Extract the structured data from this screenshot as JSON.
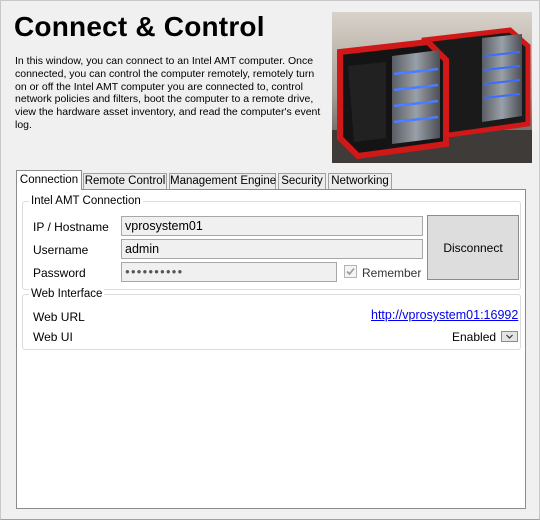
{
  "header": {
    "title": "Connect & Control",
    "description": "In this window, you can connect to an Intel AMT computer. Once connected, you can control the computer remotely, remotely turn on or off the Intel AMT computer you are connected to, control network policies and filters, boot the computer to a remote drive, view the hardware asset inventory, and read the computer's event log."
  },
  "tabs": [
    {
      "label": "Connection",
      "active": true
    },
    {
      "label": "Remote Control"
    },
    {
      "label": "Management Engine"
    },
    {
      "label": "Security"
    },
    {
      "label": "Networking"
    }
  ],
  "connection_group": {
    "title": "Intel AMT Connection",
    "host_label": "IP / Hostname",
    "host_value": "vprosystem01",
    "username_label": "Username",
    "username_value": "admin",
    "password_label": "Password",
    "password_mask": "●●●●●●●●●●",
    "remember_label": "Remember",
    "remember_checked": true,
    "disconnect_label": "Disconnect"
  },
  "web_group": {
    "title": "Web Interface",
    "url_label": "Web URL",
    "url_value": "http://vprosystem01:16992",
    "ui_label": "Web UI",
    "ui_status": "Enabled"
  },
  "icons": {
    "checkbox_check": "check-icon",
    "dropdown": "chevron-down-icon"
  },
  "colors": {
    "link": "#0000ee",
    "window_bg": "#f0f0f0",
    "hero_accent": "#d01818",
    "hero_glow": "#3a6dff"
  }
}
